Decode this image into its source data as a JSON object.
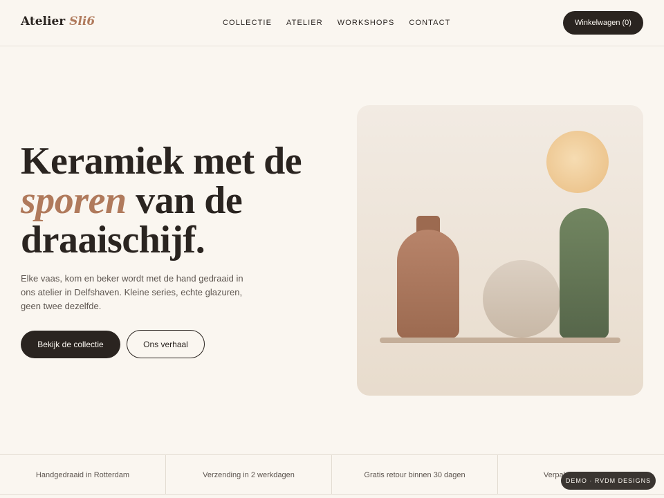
{
  "header": {
    "brand_main": "Atelier",
    "brand_accent": "Sli6",
    "nav": [
      "COLLECTIE",
      "ATELIER",
      "WORKSHOPS",
      "CONTACT"
    ],
    "cart_label": "Winkelwagen (0)"
  },
  "hero": {
    "headline_line1": "Keramiek met de",
    "headline_italic": "sporen",
    "headline_line2_rest": " van de",
    "headline_line3": "draaischijf.",
    "lead": "Elke vaas, kom en beker wordt met de hand gedraaid in ons atelier in Delfshaven. Kleine series, echte glazuren, geen twee dezelfde.",
    "primary_cta": "Bekijk de collectie",
    "secondary_cta": "Ons verhaal"
  },
  "features": [
    "Handgedraaid in Rotterdam",
    "Verzending in 2 werkdagen",
    "Gratis retour binnen 30 dagen",
    "Verpakt zonder plastic"
  ],
  "badge": "DEMO · RVDM DESIGNS",
  "colors": {
    "background": "#faf6f0",
    "ink": "#2a2420",
    "accent": "#b07a5c",
    "sage": "#56664a",
    "sun": "#edc690"
  }
}
